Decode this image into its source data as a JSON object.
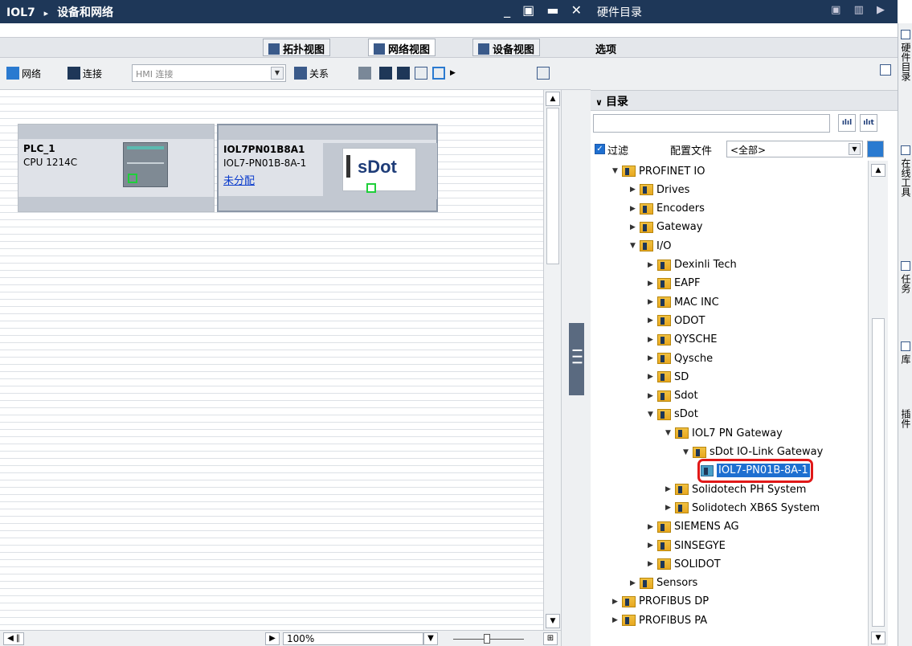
{
  "left_panel": {
    "breadcrumb_project": "IOL7",
    "breadcrumb_sep": "▸",
    "breadcrumb_page": "设备和网络",
    "window_controls": "_ ▣ ▬ ✕",
    "tabs": [
      "拓扑视图",
      "网络视图",
      "设备视图"
    ],
    "toolbar": {
      "network_label": "网络",
      "connect_label": "连接",
      "hmi_select_value": "HMI 连接",
      "relation_label": "关系"
    },
    "devices": [
      {
        "name": "PLC_1",
        "type": "CPU 1214C"
      },
      {
        "name": "IOL7PN01B8A1",
        "type": "IOL7-PN01B-8A-1",
        "link": "未分配",
        "logo": "sDot"
      }
    ],
    "zoom": "100%"
  },
  "right_panel": {
    "title": "硬件目录",
    "options_label": "选项",
    "catalog_label": "目录",
    "filter_label": "过滤",
    "profile_label": "配置文件",
    "profile_value": "<全部>",
    "search_btn_1": "ılıl",
    "search_btn_2": "ılıt",
    "tree": [
      {
        "label": "PROFINET IO",
        "level": 0,
        "expanded": true
      },
      {
        "label": "Drives",
        "level": 1,
        "expanded": false
      },
      {
        "label": "Encoders",
        "level": 1,
        "expanded": false
      },
      {
        "label": "Gateway",
        "level": 1,
        "expanded": false
      },
      {
        "label": "I/O",
        "level": 1,
        "expanded": true
      },
      {
        "label": "Dexinli Tech",
        "level": 2,
        "expanded": false
      },
      {
        "label": "EAPF",
        "level": 2,
        "expanded": false
      },
      {
        "label": "MAC INC",
        "level": 2,
        "expanded": false
      },
      {
        "label": "ODOT",
        "level": 2,
        "expanded": false
      },
      {
        "label": "QYSCHE",
        "level": 2,
        "expanded": false
      },
      {
        "label": "Qysche",
        "level": 2,
        "expanded": false
      },
      {
        "label": "SD",
        "level": 2,
        "expanded": false
      },
      {
        "label": "Sdot",
        "level": 2,
        "expanded": false
      },
      {
        "label": "sDot",
        "level": 2,
        "expanded": true
      },
      {
        "label": "IOL7 PN Gateway",
        "level": 3,
        "expanded": true
      },
      {
        "label": "sDot IO-Link Gateway",
        "level": 4,
        "expanded": true
      },
      {
        "label": "IOL7-PN01B-8A-1",
        "level": 5,
        "selected": true
      },
      {
        "label": "Solidotech PH System",
        "level": 3,
        "expanded": false
      },
      {
        "label": "Solidotech XB6S System",
        "level": 3,
        "expanded": false
      },
      {
        "label": "SIEMENS AG",
        "level": 2,
        "expanded": false
      },
      {
        "label": "SINSEGYE",
        "level": 2,
        "expanded": false
      },
      {
        "label": "SOLIDOT",
        "level": 2,
        "expanded": false
      },
      {
        "label": "Sensors",
        "level": 1,
        "expanded": false
      },
      {
        "label": "PROFIBUS DP",
        "level": 0,
        "expanded": false
      },
      {
        "label": "PROFIBUS PA",
        "level": 0,
        "expanded": false
      }
    ]
  },
  "right_sidebar": {
    "items": [
      "硬件目录",
      "在线工具",
      "任务",
      "库",
      "插件"
    ]
  }
}
